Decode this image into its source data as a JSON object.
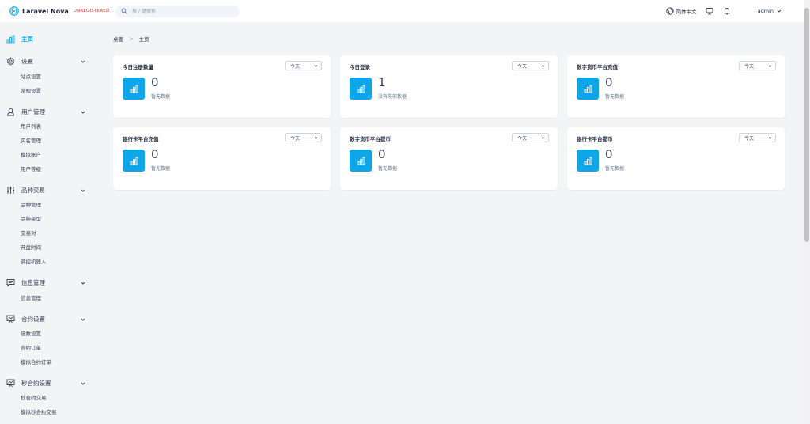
{
  "header": {
    "brand_name": "Laravel Nova",
    "brand_badge": "UNREGISTERED",
    "search_placeholder": "按 / 键搜索",
    "language": "简体中文",
    "user": "admin"
  },
  "sidebar": {
    "home": "主页",
    "groups": [
      {
        "label": "设置",
        "items": [
          "站点设置",
          "常规设置"
        ]
      },
      {
        "label": "用户管理",
        "items": [
          "用户列表",
          "实名管理",
          "模拟账户",
          "用户等级"
        ]
      },
      {
        "label": "品种交易",
        "items": [
          "品种管理",
          "品种类型",
          "交易对",
          "开盘时间",
          "调控机器人"
        ]
      },
      {
        "label": "信息管理",
        "items": [
          "信息管理"
        ]
      },
      {
        "label": "合约设置",
        "items": [
          "倍数设置",
          "合约订单",
          "模拟合约订单"
        ]
      },
      {
        "label": "秒合约设置",
        "items": [
          "秒合约交易",
          "模拟秒合约交易"
        ]
      }
    ]
  },
  "breadcrumb": {
    "root": "桌面",
    "separator": ">",
    "current": "主页"
  },
  "cards": [
    {
      "title": "今日注册数量",
      "range": "今天",
      "value": "0",
      "sub": "暂无数据"
    },
    {
      "title": "今日登录",
      "range": "今天",
      "value": "1",
      "sub": "没有先前数据"
    },
    {
      "title": "数字货币平台充值",
      "range": "今天",
      "value": "0",
      "sub": "暂无数据"
    },
    {
      "title": "银行卡平台充值",
      "range": "今天",
      "value": "0",
      "sub": "暂无数据"
    },
    {
      "title": "数字货币平台提币",
      "range": "今天",
      "value": "0",
      "sub": "暂无数据"
    },
    {
      "title": "银行卡平台提币",
      "range": "今天",
      "value": "0",
      "sub": "暂无数据"
    }
  ],
  "colors": {
    "accent": "#0ea5e9",
    "badge": "#dc2626",
    "background": "#f3f4f6"
  }
}
